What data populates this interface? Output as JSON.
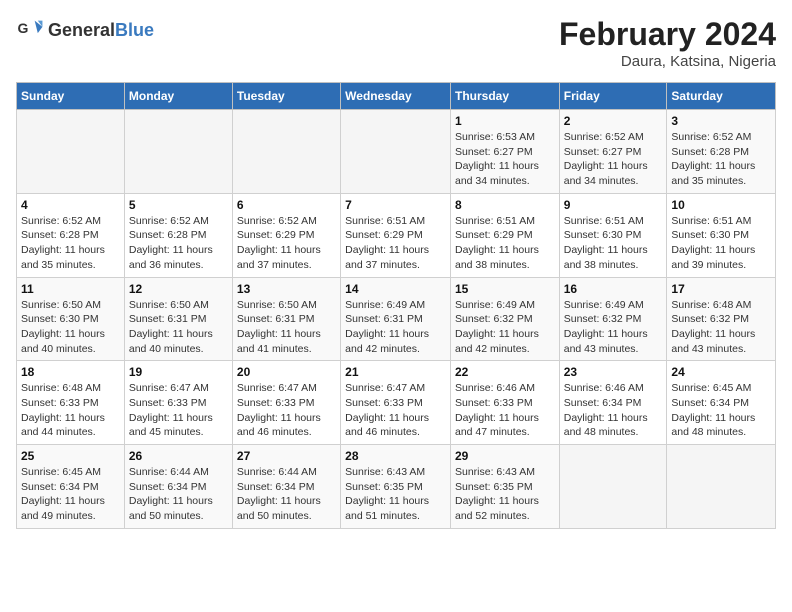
{
  "header": {
    "logo_general": "General",
    "logo_blue": "Blue",
    "month_title": "February 2024",
    "subtitle": "Daura, Katsina, Nigeria"
  },
  "days_of_week": [
    "Sunday",
    "Monday",
    "Tuesday",
    "Wednesday",
    "Thursday",
    "Friday",
    "Saturday"
  ],
  "weeks": [
    [
      {
        "day": "",
        "info": ""
      },
      {
        "day": "",
        "info": ""
      },
      {
        "day": "",
        "info": ""
      },
      {
        "day": "",
        "info": ""
      },
      {
        "day": "1",
        "info": "Sunrise: 6:53 AM\nSunset: 6:27 PM\nDaylight: 11 hours\nand 34 minutes."
      },
      {
        "day": "2",
        "info": "Sunrise: 6:52 AM\nSunset: 6:27 PM\nDaylight: 11 hours\nand 34 minutes."
      },
      {
        "day": "3",
        "info": "Sunrise: 6:52 AM\nSunset: 6:28 PM\nDaylight: 11 hours\nand 35 minutes."
      }
    ],
    [
      {
        "day": "4",
        "info": "Sunrise: 6:52 AM\nSunset: 6:28 PM\nDaylight: 11 hours\nand 35 minutes."
      },
      {
        "day": "5",
        "info": "Sunrise: 6:52 AM\nSunset: 6:28 PM\nDaylight: 11 hours\nand 36 minutes."
      },
      {
        "day": "6",
        "info": "Sunrise: 6:52 AM\nSunset: 6:29 PM\nDaylight: 11 hours\nand 37 minutes."
      },
      {
        "day": "7",
        "info": "Sunrise: 6:51 AM\nSunset: 6:29 PM\nDaylight: 11 hours\nand 37 minutes."
      },
      {
        "day": "8",
        "info": "Sunrise: 6:51 AM\nSunset: 6:29 PM\nDaylight: 11 hours\nand 38 minutes."
      },
      {
        "day": "9",
        "info": "Sunrise: 6:51 AM\nSunset: 6:30 PM\nDaylight: 11 hours\nand 38 minutes."
      },
      {
        "day": "10",
        "info": "Sunrise: 6:51 AM\nSunset: 6:30 PM\nDaylight: 11 hours\nand 39 minutes."
      }
    ],
    [
      {
        "day": "11",
        "info": "Sunrise: 6:50 AM\nSunset: 6:30 PM\nDaylight: 11 hours\nand 40 minutes."
      },
      {
        "day": "12",
        "info": "Sunrise: 6:50 AM\nSunset: 6:31 PM\nDaylight: 11 hours\nand 40 minutes."
      },
      {
        "day": "13",
        "info": "Sunrise: 6:50 AM\nSunset: 6:31 PM\nDaylight: 11 hours\nand 41 minutes."
      },
      {
        "day": "14",
        "info": "Sunrise: 6:49 AM\nSunset: 6:31 PM\nDaylight: 11 hours\nand 42 minutes."
      },
      {
        "day": "15",
        "info": "Sunrise: 6:49 AM\nSunset: 6:32 PM\nDaylight: 11 hours\nand 42 minutes."
      },
      {
        "day": "16",
        "info": "Sunrise: 6:49 AM\nSunset: 6:32 PM\nDaylight: 11 hours\nand 43 minutes."
      },
      {
        "day": "17",
        "info": "Sunrise: 6:48 AM\nSunset: 6:32 PM\nDaylight: 11 hours\nand 43 minutes."
      }
    ],
    [
      {
        "day": "18",
        "info": "Sunrise: 6:48 AM\nSunset: 6:33 PM\nDaylight: 11 hours\nand 44 minutes."
      },
      {
        "day": "19",
        "info": "Sunrise: 6:47 AM\nSunset: 6:33 PM\nDaylight: 11 hours\nand 45 minutes."
      },
      {
        "day": "20",
        "info": "Sunrise: 6:47 AM\nSunset: 6:33 PM\nDaylight: 11 hours\nand 46 minutes."
      },
      {
        "day": "21",
        "info": "Sunrise: 6:47 AM\nSunset: 6:33 PM\nDaylight: 11 hours\nand 46 minutes."
      },
      {
        "day": "22",
        "info": "Sunrise: 6:46 AM\nSunset: 6:33 PM\nDaylight: 11 hours\nand 47 minutes."
      },
      {
        "day": "23",
        "info": "Sunrise: 6:46 AM\nSunset: 6:34 PM\nDaylight: 11 hours\nand 48 minutes."
      },
      {
        "day": "24",
        "info": "Sunrise: 6:45 AM\nSunset: 6:34 PM\nDaylight: 11 hours\nand 48 minutes."
      }
    ],
    [
      {
        "day": "25",
        "info": "Sunrise: 6:45 AM\nSunset: 6:34 PM\nDaylight: 11 hours\nand 49 minutes."
      },
      {
        "day": "26",
        "info": "Sunrise: 6:44 AM\nSunset: 6:34 PM\nDaylight: 11 hours\nand 50 minutes."
      },
      {
        "day": "27",
        "info": "Sunrise: 6:44 AM\nSunset: 6:34 PM\nDaylight: 11 hours\nand 50 minutes."
      },
      {
        "day": "28",
        "info": "Sunrise: 6:43 AM\nSunset: 6:35 PM\nDaylight: 11 hours\nand 51 minutes."
      },
      {
        "day": "29",
        "info": "Sunrise: 6:43 AM\nSunset: 6:35 PM\nDaylight: 11 hours\nand 52 minutes."
      },
      {
        "day": "",
        "info": ""
      },
      {
        "day": "",
        "info": ""
      }
    ]
  ]
}
